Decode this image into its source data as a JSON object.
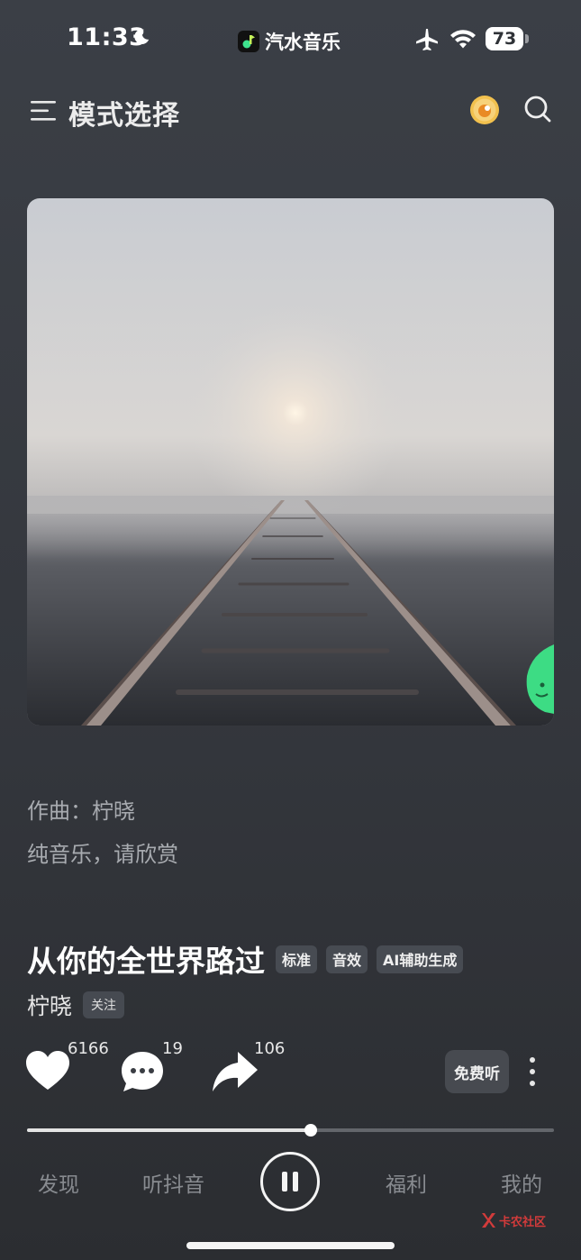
{
  "status_bar": {
    "time": "11:33",
    "app_name": "汽水音乐",
    "battery": "73"
  },
  "header": {
    "title": "模式选择"
  },
  "credits": {
    "composer": "作曲：柠晓",
    "note": "纯音乐，请欣赏"
  },
  "song": {
    "title": "从你的全世界路过",
    "tags": [
      "标准",
      "音效",
      "AI辅助生成"
    ],
    "artist": "柠晓",
    "follow_label": "关注"
  },
  "actions": {
    "likes": "6166",
    "comments": "19",
    "shares": "106",
    "free_listen_label": "免费听"
  },
  "playback": {
    "progress": 0.538,
    "state": "playing"
  },
  "nav": {
    "items": [
      "发现",
      "听抖音",
      "福利",
      "我的"
    ]
  },
  "watermark": {
    "text": "卡农社区"
  },
  "colors": {
    "background": "#3b3f46",
    "tag_bg": "#474b52",
    "muted_text": "#a8abb0"
  }
}
